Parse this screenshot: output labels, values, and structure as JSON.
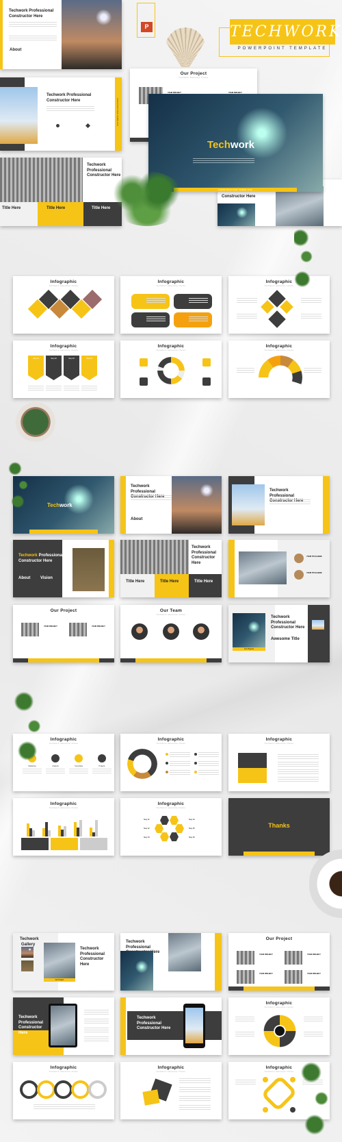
{
  "brand": {
    "name": "TECHWORK",
    "tagline": "POWERPOINT TEMPLATE",
    "icon": "powerpoint-icon",
    "colors": {
      "accent": "#f6c417",
      "dark": "#3d3d3d",
      "orange": "#f5a10f",
      "brown": "#c8893a"
    }
  },
  "hero": {
    "s1": {
      "title": "Techwork Professional Constructor Here",
      "about": "About"
    },
    "s2": {
      "title": "Techwork Professional Constructor Here",
      "side": "CONSTRUCTOR TEMPLATE"
    },
    "s3": {
      "title": "Techwork Professional Constructor Here",
      "cols": [
        "Title Here",
        "Title Here",
        "Title Here"
      ]
    },
    "s4": {
      "title": "Our Project",
      "subtitle": "Techwork Awesome Theme",
      "labels": [
        "YOUR PROJECT",
        "YOUR PROJECT"
      ]
    },
    "s5": {
      "title": "Constructor Here"
    },
    "cover": {
      "title_a": "Tech",
      "title_b": "work",
      "bar": "CONSTRUCTOR TEMPLATE"
    }
  },
  "sections": [
    {
      "slides": [
        {
          "type": "info",
          "title": "Infographic",
          "subtitle": "Techwork awesome theme",
          "pattern": "diamonds"
        },
        {
          "type": "info",
          "title": "Infographic",
          "subtitle": "Techwork awesome theme",
          "pattern": "pills"
        },
        {
          "type": "info",
          "title": "Infographic",
          "subtitle": "Techwork awesome theme",
          "pattern": "quad"
        },
        {
          "type": "info",
          "title": "Infographic",
          "subtitle": "Techwork awesome theme",
          "pattern": "steps",
          "labels": [
            "Step 01",
            "Step 02",
            "Step 03",
            "Step 04"
          ]
        },
        {
          "type": "info",
          "title": "Infographic",
          "subtitle": "Techwork awesome theme",
          "pattern": "cycle"
        },
        {
          "type": "info",
          "title": "Infographic",
          "subtitle": "Techwork awesome theme",
          "pattern": "arc"
        }
      ]
    },
    {
      "slides": [
        {
          "type": "cover",
          "title_a": "Tech",
          "title_b": "work"
        },
        {
          "type": "photo-right",
          "title": "Techwork Professional Constructor Here",
          "about": "About"
        },
        {
          "type": "photo-left",
          "title": "Techwork Professional Constructor Here"
        },
        {
          "type": "dark-left",
          "title_a": "Techwork",
          "title_b": "Professional Constructor Here",
          "cols": [
            "About",
            "Vision"
          ]
        },
        {
          "type": "three-col",
          "title": "Techwork Professional Constructor Here",
          "cols": [
            "Title Here",
            "Title Here",
            "Title Here"
          ]
        },
        {
          "type": "profiles",
          "labels": [
            "YOUR TITLE HERE",
            "YOUR TITLE HERE"
          ]
        },
        {
          "type": "project",
          "title": "Our Project",
          "labels": [
            "YOUR PROJECT",
            "YOUR PROJECT"
          ]
        },
        {
          "type": "team",
          "title": "Our Team",
          "subtitle": "Techwork awesome theme"
        },
        {
          "type": "awesome",
          "title": "Techwork Professional Constructor Here",
          "sub": "Awesome Title",
          "tag": "Our Projects"
        }
      ]
    },
    {
      "slides": [
        {
          "type": "info",
          "title": "Infographic",
          "subtitle": "Techwork awesome theme",
          "pattern": "circles",
          "labels": [
            "Marketing",
            "Analysis",
            "Consulting",
            "Projects"
          ]
        },
        {
          "type": "info",
          "title": "Infographic",
          "subtitle": "Techwork awesome theme",
          "pattern": "ring"
        },
        {
          "type": "info",
          "title": "Infographic",
          "subtitle": "Techwork awesome theme",
          "pattern": "puzzle"
        },
        {
          "type": "info",
          "title": "Infographic",
          "subtitle": "Techwork awesome theme",
          "pattern": "bars"
        },
        {
          "type": "info",
          "title": "Infographic",
          "subtitle": "Techwork awesome theme",
          "pattern": "hex",
          "labels": [
            "Step 01",
            "Step 02",
            "Step 03",
            "Step 04",
            "Step 05",
            "Step 06"
          ]
        },
        {
          "type": "thanks",
          "title": "Thanks"
        }
      ]
    },
    {
      "slides": [
        {
          "type": "gallery",
          "title_a": "Techwork Gallery",
          "title": "Techwork Professional Constructor Here",
          "tag": "Our Project"
        },
        {
          "type": "photo-left2",
          "title": "Techwork Professional Constructor Here"
        },
        {
          "type": "project",
          "title": "Our Project",
          "labels": [
            "YOUR PROJECT",
            "YOUR PROJECT",
            "YOUR PROJECT",
            "YOUR PROJECT"
          ]
        },
        {
          "type": "tablet",
          "title": "Techwork Professional Constructor Here"
        },
        {
          "type": "phone",
          "title": "Techwork Professional Constructor Here"
        },
        {
          "type": "info",
          "title": "Infographic",
          "subtitle": "Techwork awesome theme",
          "pattern": "donut"
        },
        {
          "type": "info",
          "title": "Infographic",
          "subtitle": "Techwork awesome theme",
          "pattern": "chain"
        },
        {
          "type": "info",
          "title": "Infographic",
          "subtitle": "Techwork awesome theme",
          "pattern": "radar"
        },
        {
          "type": "info",
          "title": "Infographic",
          "subtitle": "Techwork awesome theme",
          "pattern": "links"
        }
      ]
    }
  ]
}
